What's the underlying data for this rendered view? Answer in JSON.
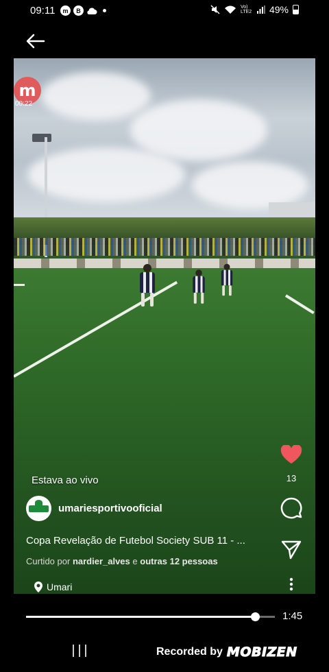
{
  "status_bar": {
    "time": "09:11",
    "app_icons": [
      "m",
      "B",
      "cloud-icon"
    ],
    "network_label": "Vo) LTE2",
    "battery": "49%",
    "battery_level": 0.49
  },
  "video": {
    "logo_letter": "m",
    "logo_time": "00:22",
    "live_label": "Estava ao vivo",
    "account_name": "umariesportivooficial",
    "caption": "Copa Revelação de Futebol Society SUB 11 - ...",
    "liked_prefix": "Curtido por",
    "liked_user": "nardier_alves",
    "liked_mid": "e",
    "liked_others": "outras 12 pessoas",
    "location": "Umari",
    "like_count": "13"
  },
  "playback": {
    "duration": "1:45",
    "progress": 0.92
  },
  "nav": {
    "recorded_by": "Recorded by",
    "recorder_brand": "MOBIZEN"
  },
  "colors": {
    "like_heart": "#f0565d",
    "background": "#000000"
  }
}
